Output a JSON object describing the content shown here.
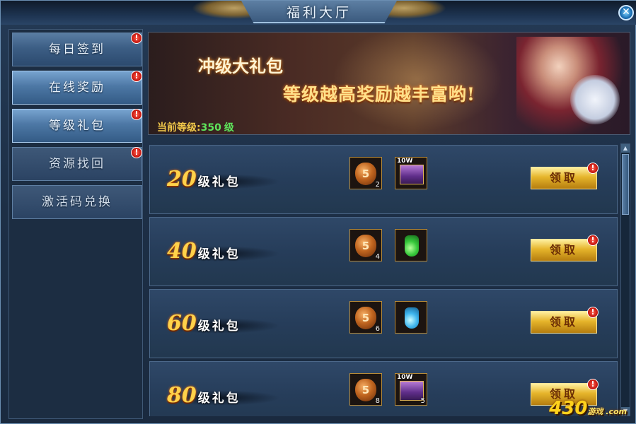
{
  "window": {
    "title": "福利大厅"
  },
  "sidebar": {
    "items": [
      {
        "label": "每日签到",
        "badge": "!"
      },
      {
        "label": "在线奖励",
        "badge": "!"
      },
      {
        "label": "等级礼包",
        "badge": "!"
      },
      {
        "label": "资源找回",
        "badge": "!"
      },
      {
        "label": "激活码兑换",
        "badge": ""
      }
    ]
  },
  "banner": {
    "title": "冲级大礼包",
    "subtitle": "等级越高奖励越丰富哟!",
    "level_label": "当前等级:",
    "level_value": "350",
    "level_unit": "级"
  },
  "rewards": [
    {
      "level": "20",
      "suffix": "级礼包",
      "items": [
        {
          "icon": "gourd-icon",
          "count": "2"
        },
        {
          "icon": "chest-icon",
          "tag": "10W",
          "count": ""
        }
      ],
      "button": "领取",
      "badge": "!"
    },
    {
      "level": "40",
      "suffix": "级礼包",
      "items": [
        {
          "icon": "gourd-icon",
          "count": "4"
        },
        {
          "icon": "green-potion-icon",
          "count": ""
        }
      ],
      "button": "领取",
      "badge": "!"
    },
    {
      "level": "60",
      "suffix": "级礼包",
      "items": [
        {
          "icon": "gourd-icon",
          "count": "6"
        },
        {
          "icon": "blue-potion-icon",
          "count": ""
        }
      ],
      "button": "领取",
      "badge": "!"
    },
    {
      "level": "80",
      "suffix": "级礼包",
      "items": [
        {
          "icon": "gourd-icon",
          "count": "8"
        },
        {
          "icon": "chest-icon",
          "tag": "10W",
          "count": "5"
        }
      ],
      "button": "领取",
      "badge": "!"
    }
  ],
  "gourd_glyph": "5",
  "watermark": {
    "main": "430",
    "small": "游戏 .com"
  },
  "colors": {
    "accent_gold": "#e6b52b",
    "level_green": "#5ee45b",
    "badge_red": "#c0120b"
  }
}
